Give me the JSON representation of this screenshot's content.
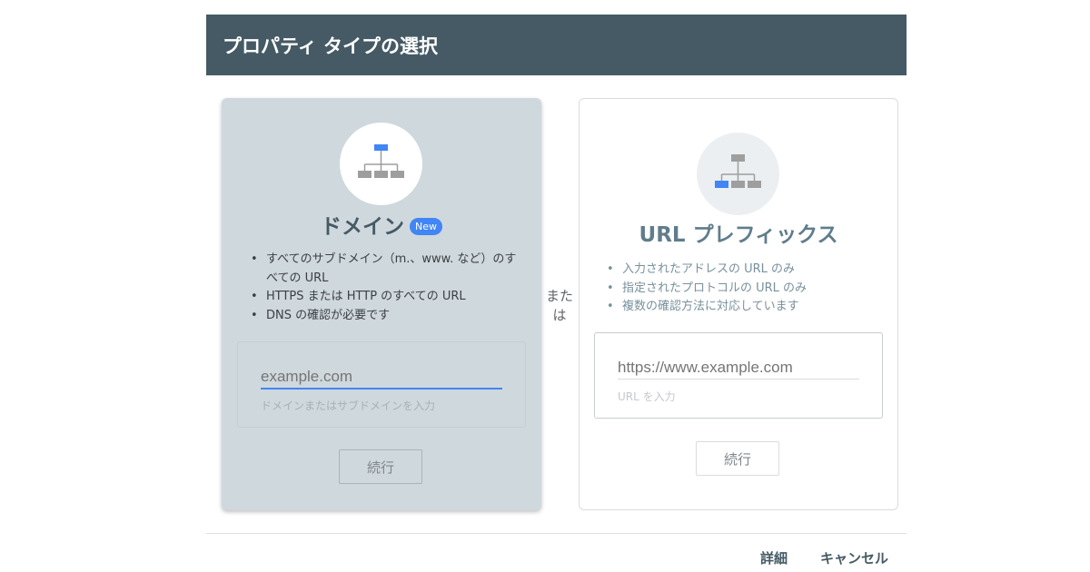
{
  "dialog": {
    "title": "プロパティ タイプの選択"
  },
  "domain_card": {
    "icon": "sitemap-top-highlight-icon",
    "title": "ドメイン",
    "badge": "New",
    "features": [
      "すべてのサブドメイン（m.、www. など）のすべての URL",
      "HTTPS または HTTP のすべての URL",
      "DNS の確認が必要です"
    ],
    "input_placeholder": "example.com",
    "input_value": "",
    "hint": "ドメインまたはサブドメインを入力",
    "continue_label": "続行"
  },
  "separator": {
    "line1": "また",
    "line2": "は"
  },
  "url_card": {
    "icon": "sitemap-bottom-left-highlight-icon",
    "title": "URL プレフィックス",
    "features": [
      "入力されたアドレスの URL のみ",
      "指定されたプロトコルの URL のみ",
      "複数の確認方法に対応しています"
    ],
    "input_placeholder": "https://www.example.com",
    "input_value": "",
    "hint": "URL を入力",
    "continue_label": "続行"
  },
  "footer": {
    "details_label": "詳細",
    "cancel_label": "キャンセル"
  },
  "colors": {
    "header_bg": "#455a64",
    "accent": "#4285f4",
    "domain_card_bg": "#cfd8dd"
  }
}
